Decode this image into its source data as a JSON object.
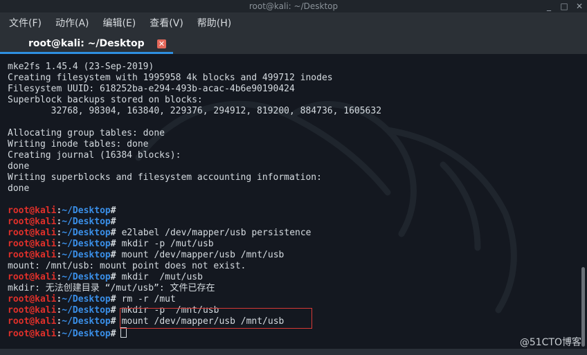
{
  "window": {
    "title": "root@kali: ~/Desktop",
    "minimize": "_",
    "maximize": "□",
    "close": "✕"
  },
  "menu": [
    "文件(F)",
    "动作(A)",
    "编辑(E)",
    "查看(V)",
    "帮助(H)"
  ],
  "tab": {
    "label": "root@kali: ~/Desktop",
    "close": "✕"
  },
  "prompt": {
    "user": "root@kali",
    "sep": ":",
    "path": "~/Desktop",
    "hash": "#"
  },
  "lines": [
    {
      "type": "text",
      "text": "mke2fs 1.45.4 (23-Sep-2019)"
    },
    {
      "type": "text",
      "text": "Creating filesystem with 1995958 4k blocks and 499712 inodes"
    },
    {
      "type": "text",
      "text": "Filesystem UUID: 618252ba-e294-493b-acac-4b6e90190424"
    },
    {
      "type": "text",
      "text": "Superblock backups stored on blocks:"
    },
    {
      "type": "text",
      "text": "        32768, 98304, 163840, 229376, 294912, 819200, 884736, 1605632"
    },
    {
      "type": "text",
      "text": ""
    },
    {
      "type": "text",
      "text": "Allocating group tables: done"
    },
    {
      "type": "text",
      "text": "Writing inode tables: done"
    },
    {
      "type": "text",
      "text": "Creating journal (16384 blocks):"
    },
    {
      "type": "text",
      "text": "done"
    },
    {
      "type": "text",
      "text": "Writing superblocks and filesystem accounting information:"
    },
    {
      "type": "text",
      "text": "done"
    },
    {
      "type": "text",
      "text": ""
    },
    {
      "type": "prompt",
      "cmd": ""
    },
    {
      "type": "prompt",
      "cmd": ""
    },
    {
      "type": "prompt",
      "cmd": "e2label /dev/mapper/usb persistence"
    },
    {
      "type": "prompt",
      "cmd": "mkdir -p /mut/usb"
    },
    {
      "type": "prompt",
      "cmd": "mount /dev/mapper/usb /mnt/usb"
    },
    {
      "type": "text",
      "text": "mount: /mnt/usb: mount point does not exist."
    },
    {
      "type": "prompt",
      "cmd": "mkdir  /mut/usb"
    },
    {
      "type": "text",
      "text": "mkdir: 无法创建目录 “/mut/usb”: 文件已存在"
    },
    {
      "type": "prompt",
      "cmd": "rm -r /mut"
    },
    {
      "type": "prompt",
      "cmd": "mkdir -p  /mnt/usb"
    },
    {
      "type": "prompt",
      "cmd": "mount /dev/mapper/usb /mnt/usb"
    },
    {
      "type": "prompt",
      "cmd": "",
      "cursor": true
    }
  ],
  "watermark": "@51CTO博客"
}
